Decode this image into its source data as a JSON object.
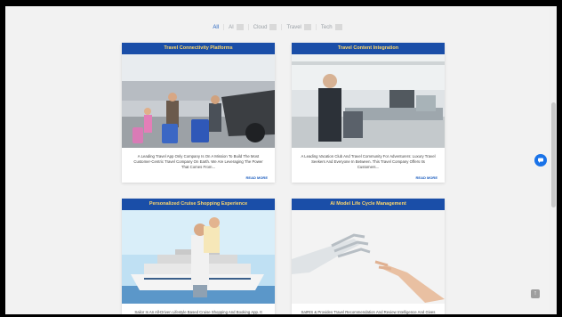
{
  "filters": [
    {
      "label": "All",
      "active": true
    },
    {
      "label": "AI",
      "active": false
    },
    {
      "label": "Cloud",
      "active": false
    },
    {
      "label": "Travel",
      "active": false
    },
    {
      "label": "Tech",
      "active": false
    }
  ],
  "cards": [
    {
      "title": "Travel Connectivity Platforms",
      "description": "A Leading Travel App Only Company Is On A Mission To Build The Most Customer-Centric Travel Company On Earth. We Are Leveraging The Power That Comes From...",
      "read_more": "READ MORE",
      "image": "family-travel-airport"
    },
    {
      "title": "Travel Content Integration",
      "description": "A Leading Vacation Club And Travel Community For Adventurers: Luxury Travel Seekers And Everyone In Between. This Travel Company Offers Its Customers...",
      "read_more": "READ MORE",
      "image": "airport-checkin-counter"
    },
    {
      "title": "Personalized Cruise Shopping Experience",
      "description": "Sailor Is An All-Driven Lifestyle Based Cruise Shopping And Booking App. It Helps Millennials With Their Top Budget-Based Planning Scenarios Used...",
      "image": "couple-cruise-ship"
    },
    {
      "title": "AI Model Life Cycle Management",
      "description": "SatRIS & Provides Travel Recommendation And Review Intelligence And Gives Ideas For Leisure/Holiday And Tell Destinations For Travelers That Will...",
      "image": "robot-human-hands"
    }
  ],
  "icons": {
    "chat": "chat-bubble-icon",
    "to_top": "arrow-up-icon",
    "to_top_glyph": "↑"
  },
  "colors": {
    "card_title_bg": "#1a4ea8",
    "card_title_text": "#ffd86b",
    "accent": "#1f5fbf",
    "page_bg": "#f2f2f2"
  }
}
